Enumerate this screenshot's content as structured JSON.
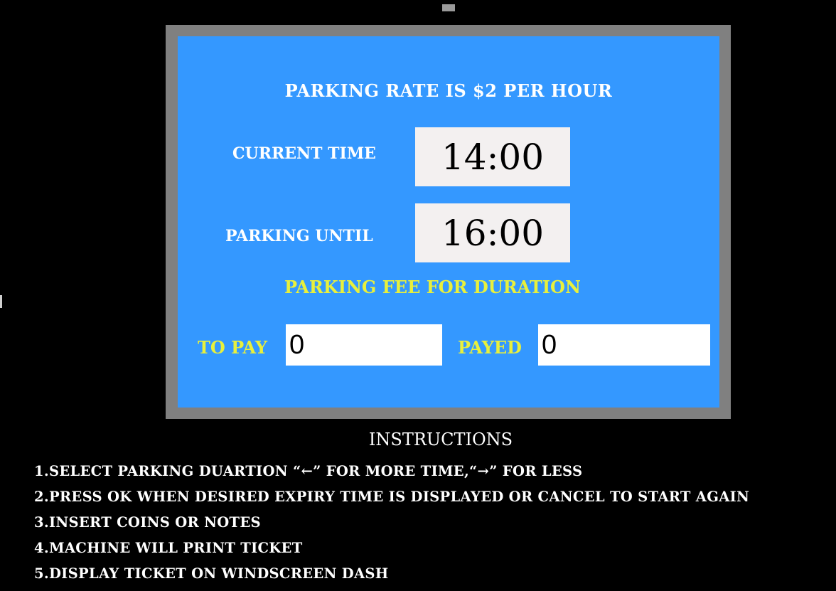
{
  "screen": {
    "rate_title": "PARKING RATE IS $2 PER HOUR",
    "current_time_label": "CURRENT TIME",
    "current_time_value": "14:00",
    "parking_until_label": "PARKING UNTIL",
    "parking_until_value": "16:00",
    "fee_title": "PARKING FEE FOR DURATION",
    "to_pay_label": "TO PAY",
    "to_pay_value": "0",
    "payed_label": "PAYED",
    "payed_value": "0"
  },
  "instructions": {
    "title": "INSTRUCTIONS",
    "items": [
      "1.SELECT PARKING DUARTION “←” FOR MORE TIME,“→” FOR LESS",
      "2.PRESS OK WHEN DESIRED EXPIRY TIME IS DISPLAYED OR CANCEL TO START AGAIN",
      "3.INSERT COINS OR NOTES",
      "4.MACHINE WILL PRINT TICKET",
      "5.DISPLAY TICKET ON WINDSCREEN DASH"
    ]
  },
  "colors": {
    "background": "#000000",
    "frame": "#808080",
    "screen": "#3498ff",
    "label_white": "#ffffff",
    "label_yellow": "#e8f03c",
    "time_box": "#f3f0f0"
  }
}
